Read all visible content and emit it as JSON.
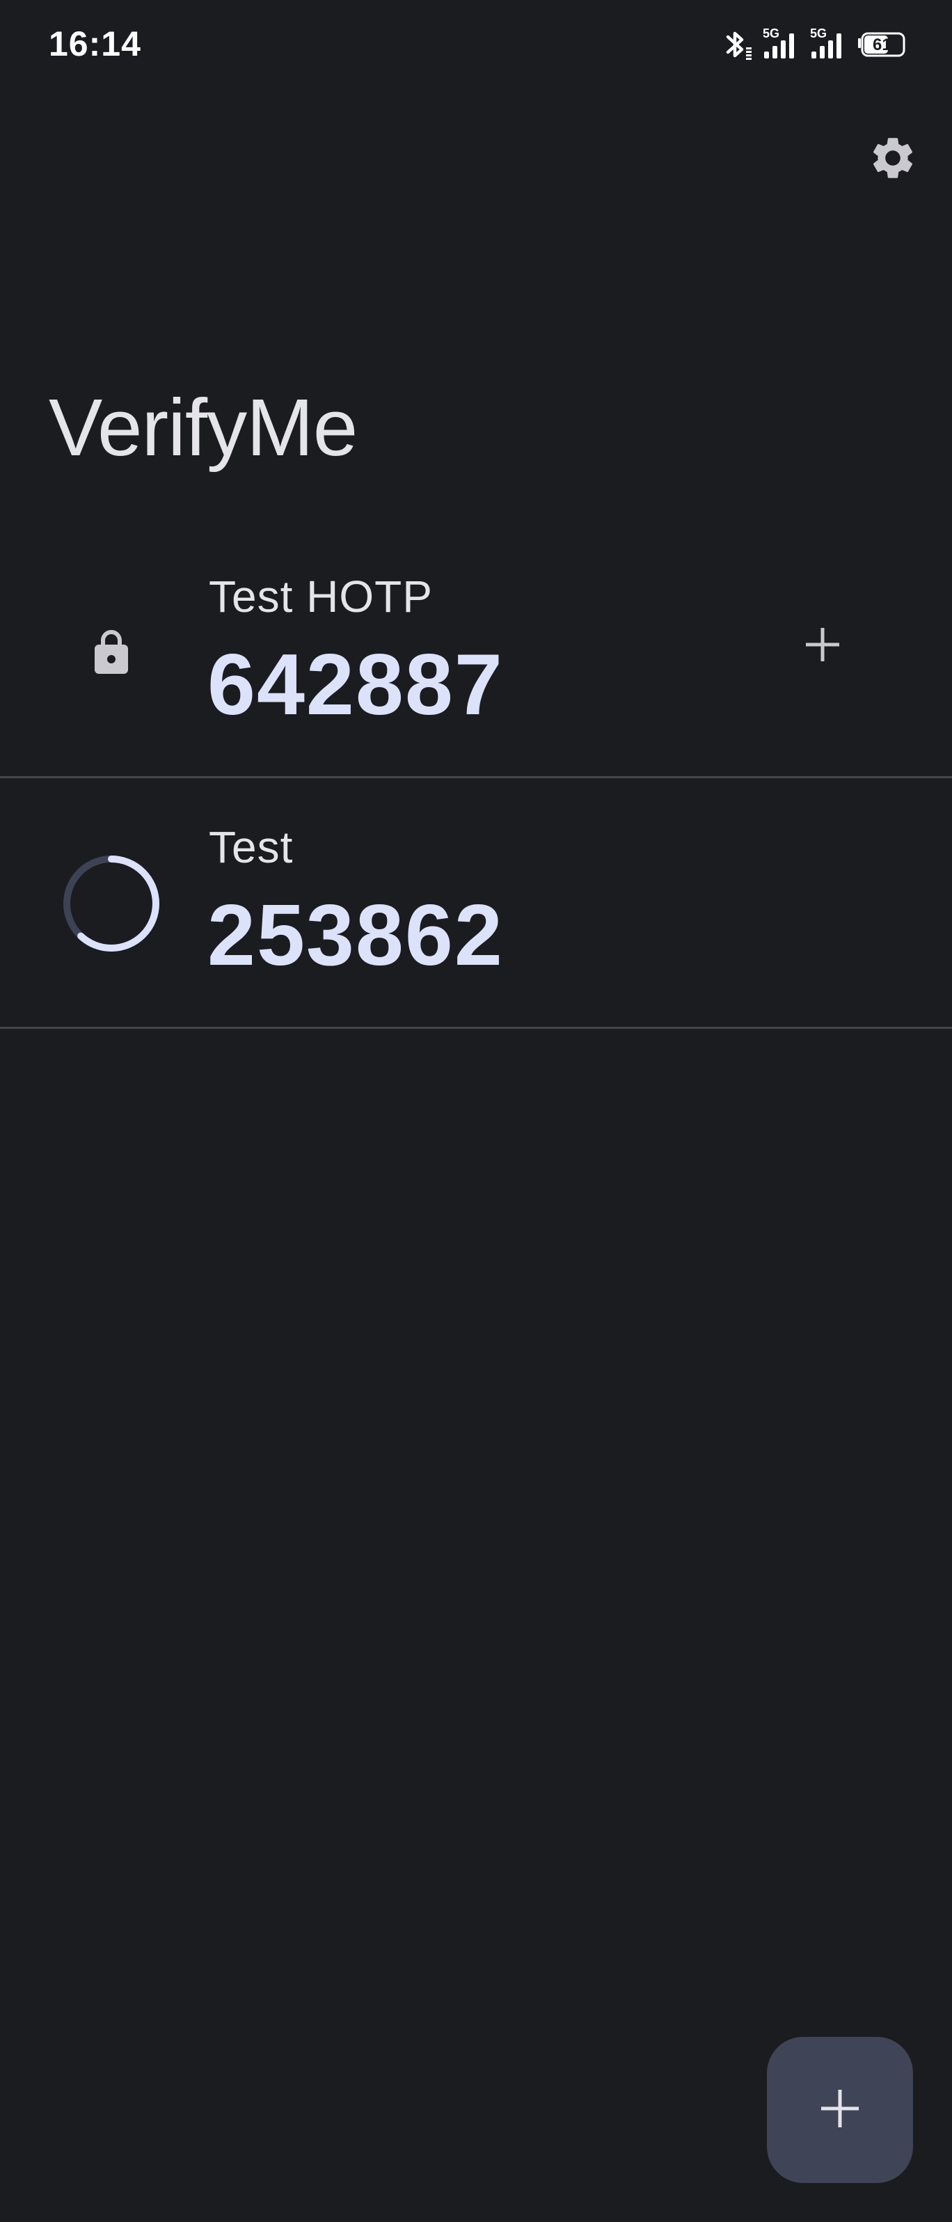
{
  "status_bar": {
    "time": "16:14",
    "battery_level": "61",
    "network_1": "5G",
    "network_2": "5G",
    "icons": [
      "bluetooth-icon",
      "signal-icon",
      "signal-icon",
      "battery-icon"
    ]
  },
  "header": {
    "settings_icon": "gear-icon"
  },
  "app": {
    "title": "VerifyMe"
  },
  "tokens": [
    {
      "type": "HOTP",
      "name": "Test HOTP",
      "code": "642887",
      "leading_icon": "lock-icon",
      "action_icon": "plus-icon"
    },
    {
      "type": "TOTP",
      "name": "Test",
      "code": "253862",
      "leading_icon": "countdown-ring-icon",
      "time_remaining_fraction": 0.62
    }
  ],
  "fab": {
    "icon": "plus-icon"
  },
  "colors": {
    "background": "#1b1c20",
    "code_text": "#dde2fb",
    "progress_active": "#dde2fb",
    "progress_track": "#3d4254",
    "fab_background": "#404457",
    "divider": "#45464c"
  }
}
